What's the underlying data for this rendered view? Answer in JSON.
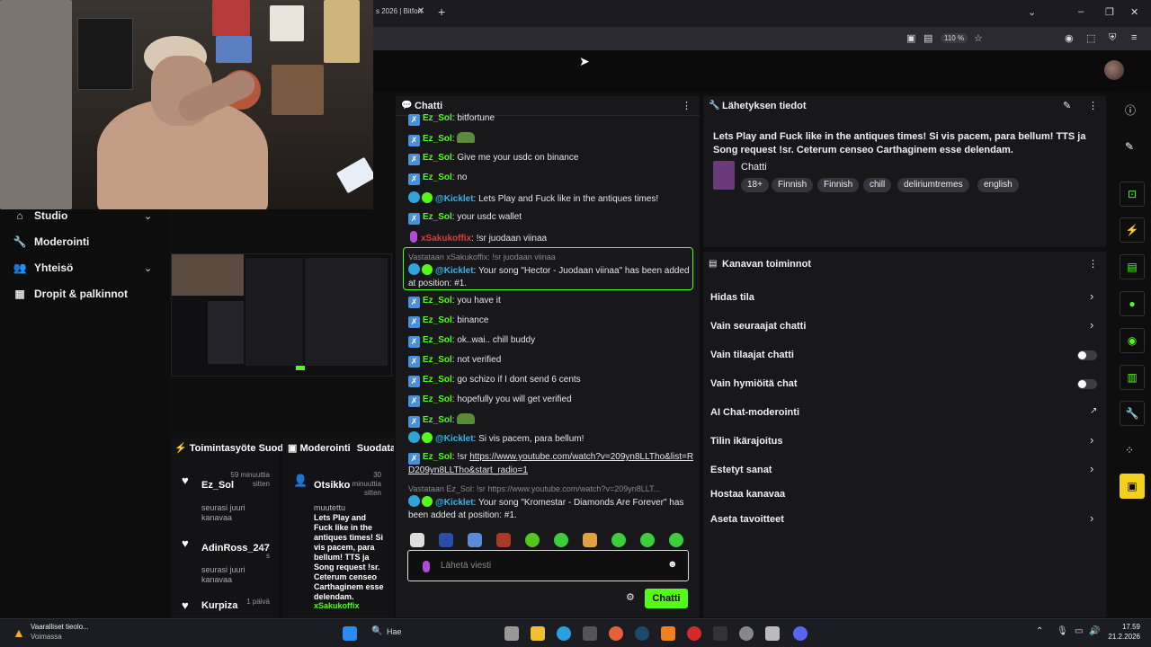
{
  "browser": {
    "tab_title": "s 2026 | Bitfortune",
    "zoom": "110 %"
  },
  "sidebar": {
    "items": [
      {
        "label": "Studio",
        "has_chevron": true
      },
      {
        "label": "Moderointi",
        "has_chevron": false
      },
      {
        "label": "Yhteisö",
        "has_chevron": true
      },
      {
        "label": "Dropit & palkinnot",
        "has_chevron": false
      }
    ]
  },
  "activity": {
    "title": "Toimintasyöte",
    "title2": "Suodata",
    "items": [
      {
        "name": "Ez_Sol",
        "time": "59 minuuttia sitten",
        "sub": "seurasi juuri kanavaa"
      },
      {
        "name": "AdinRoss_247",
        "time": "t... s",
        "sub": "seurasi juuri kanavaa"
      },
      {
        "name": "Kurpiza",
        "time": "1 päivä",
        "sub": ""
      }
    ]
  },
  "moderation": {
    "title": "Moderointi",
    "filter": "Suodata",
    "name": "Otsikko",
    "time": "30 minuuttia sitten",
    "changed": "muutettu",
    "text": "Lets Play and Fuck like in the antiques times! Si vis pacem, para bellum! TTS ja Song request !sr. Ceterum censeo Carthaginem esse delendam.",
    "by": "xSakukoffix"
  },
  "chat": {
    "title": "Chatti",
    "messages": [
      {
        "user": "Ez_Sol",
        "text": "bitfortune",
        "type": "ez"
      },
      {
        "user": "Ez_Sol",
        "text": "",
        "type": "ez",
        "emote": true
      },
      {
        "user": "Ez_Sol",
        "text": "Give me your usdc on binance",
        "type": "ez"
      },
      {
        "user": "Ez_Sol",
        "text": "no",
        "type": "ez"
      },
      {
        "user": "@Kicklet",
        "text": "Lets Play and Fuck like in the antiques times!",
        "type": "kick"
      },
      {
        "user": "Ez_Sol",
        "text": "your usdc wallet",
        "type": "ez"
      },
      {
        "user": "xSakukoffix",
        "text": "!sr juodaan viinaa",
        "type": "saku"
      },
      {
        "reply": "Vastataan xSakukoffix: !sr juodaan viinaa",
        "user": "@Kicklet",
        "text": "Your song \"Hector - Juodaan viinaa\" has been added at position: #1.",
        "type": "kick"
      },
      {
        "user": "Ez_Sol",
        "text": "you have it",
        "type": "ez"
      },
      {
        "user": "Ez_Sol",
        "text": "binance",
        "type": "ez"
      },
      {
        "user": "Ez_Sol",
        "text": "ok..wai.. chill buddy",
        "type": "ez"
      },
      {
        "user": "Ez_Sol",
        "text": "not verified",
        "type": "ez"
      },
      {
        "user": "Ez_Sol",
        "text": "go schizo if I dont send 6 cents",
        "type": "ez"
      },
      {
        "user": "Ez_Sol",
        "text": "hopefully you will get verified",
        "type": "ez"
      },
      {
        "user": "Ez_Sol",
        "text": "",
        "type": "ez",
        "emote": true
      },
      {
        "user": "@Kicklet",
        "text": "Si vis pacem, para bellum!",
        "type": "kick"
      },
      {
        "user": "Ez_Sol",
        "text": "!sr ",
        "link": "https://www.youtube.com/watch?v=209yn8LLTho&list=RD209yn8LLTho&start_radio=1",
        "type": "ez"
      },
      {
        "reply": "Vastataan Ez_Sol: !sr https://www.youtube.com/watch?v=209yn8LLT...",
        "user": "@Kicklet",
        "text": "Your song \"Kromestar - Diamonds Are Forever\" has been added at position: #1.",
        "type": "kick"
      }
    ],
    "input_placeholder": "Lähetä viesti",
    "send_label": "Chatti"
  },
  "stream_info": {
    "title": "Lähetyksen tiedot",
    "description": "Lets Play and Fuck like in the antiques times! Si vis pacem, para bellum! TTS ja Song request !sr. Ceterum censeo Carthaginem esse delendam.",
    "category": "Chatti",
    "tags": [
      "18+",
      "Finnish",
      "Finnish",
      "chill",
      "deliriumtremes",
      "english"
    ]
  },
  "channel_actions": {
    "title": "Kanavan toiminnot",
    "rows": [
      {
        "label": "Hidas tila",
        "control": "chevron"
      },
      {
        "label": "Vain seuraajat chatti",
        "control": "chevron"
      },
      {
        "label": "Vain tilaajat chatti",
        "control": "toggle",
        "on": false
      },
      {
        "label": "Vain hymiöitä chat",
        "control": "toggle",
        "on": false
      },
      {
        "label": "AI Chat-moderointi",
        "control": "external"
      },
      {
        "label": "Tilin ikärajoitus",
        "control": "chevron"
      },
      {
        "label": "Estetyt sanat",
        "control": "chevron"
      },
      {
        "label": "Hostaa kanavaa",
        "control": "none"
      },
      {
        "label": "Aseta tavoitteet",
        "control": "chevron"
      }
    ]
  },
  "taskbar": {
    "notification_title": "Vaaralliset tieolo...",
    "notification_sub": "Voimassa",
    "search": "Hae",
    "time": "17.59",
    "date": "21.2.2026"
  },
  "colors": {
    "accent": "#53fc18",
    "bg": "#18181b"
  }
}
